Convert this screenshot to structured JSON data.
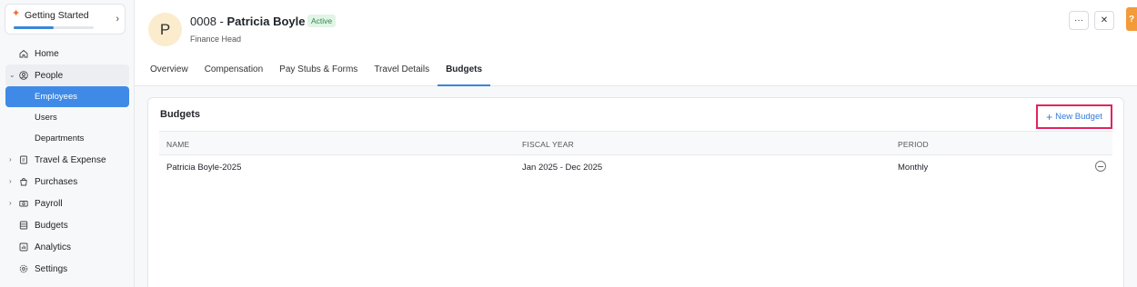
{
  "getting_started": {
    "label": "Getting Started",
    "progress": 0.5
  },
  "sidebar": {
    "items": [
      {
        "label": "Home",
        "icon": "home-icon"
      },
      {
        "label": "People",
        "icon": "user-circle-icon"
      },
      {
        "label": "Travel & Expense",
        "icon": "receipt-icon"
      },
      {
        "label": "Purchases",
        "icon": "bag-icon"
      },
      {
        "label": "Payroll",
        "icon": "cash-icon"
      },
      {
        "label": "Budgets",
        "icon": "ledger-icon"
      },
      {
        "label": "Analytics",
        "icon": "chart-icon"
      },
      {
        "label": "Settings",
        "icon": "gear-icon"
      }
    ],
    "people_sub": [
      {
        "label": "Employees"
      },
      {
        "label": "Users"
      },
      {
        "label": "Departments"
      }
    ]
  },
  "employee": {
    "initial": "P",
    "id": "0008 -",
    "name": "Patricia Boyle",
    "status": "Active",
    "role": "Finance Head"
  },
  "header": {
    "more_label": "···",
    "close_label": "✕",
    "help_label": "?"
  },
  "tabs": [
    {
      "label": "Overview"
    },
    {
      "label": "Compensation"
    },
    {
      "label": "Pay Stubs & Forms"
    },
    {
      "label": "Travel Details"
    },
    {
      "label": "Budgets"
    }
  ],
  "budgets": {
    "title": "Budgets",
    "new_button": "New Budget",
    "columns": [
      "NAME",
      "FISCAL YEAR",
      "PERIOD"
    ],
    "rows": [
      {
        "name": "Patricia Boyle-2025",
        "fiscal_year": "Jan 2025 - Dec 2025",
        "period": "Monthly"
      }
    ]
  },
  "colors": {
    "accent": "#3a86d9",
    "highlight": "#e0245e",
    "status_green": "#2f8a4c"
  }
}
